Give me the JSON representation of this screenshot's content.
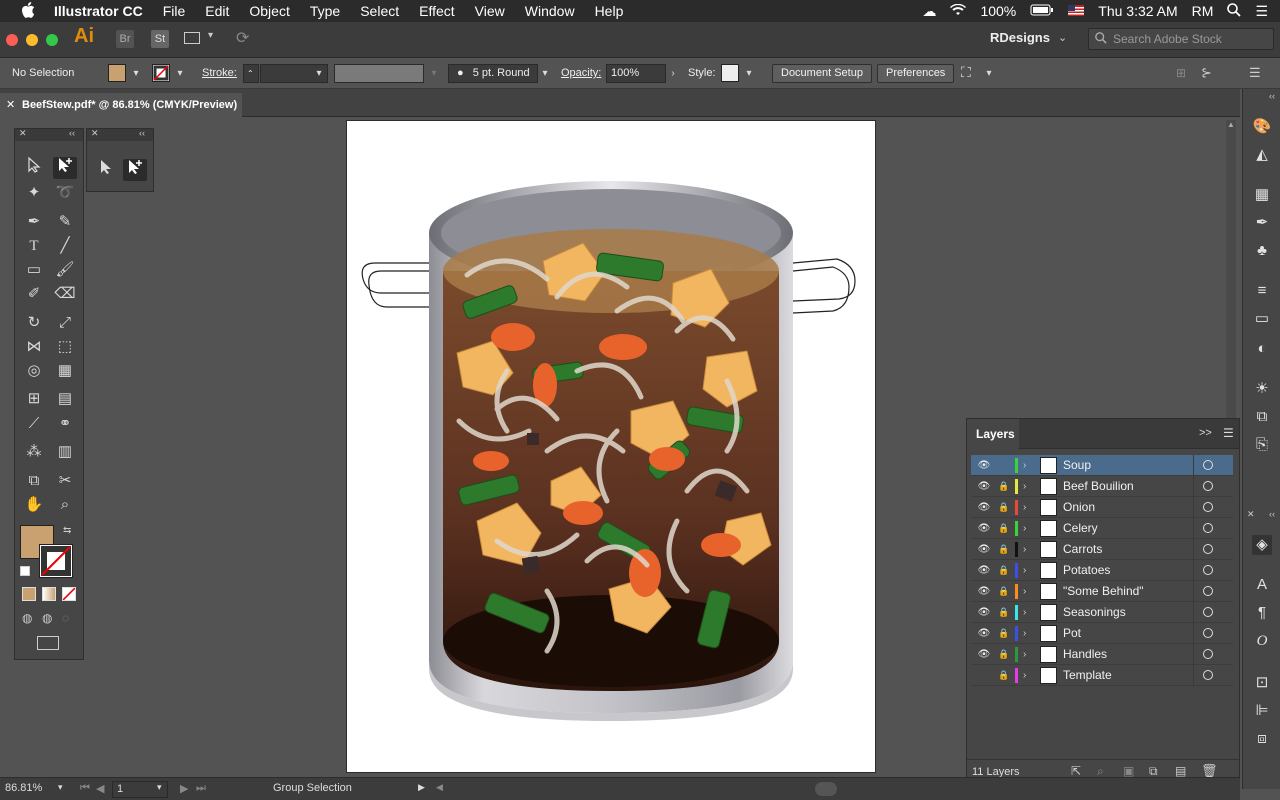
{
  "menubar": {
    "apple": "",
    "app": "Illustrator CC",
    "items": [
      "File",
      "Edit",
      "Object",
      "Type",
      "Select",
      "Effect",
      "View",
      "Window",
      "Help"
    ],
    "battery": "100%",
    "clock": "Thu 3:32 AM",
    "user": "RM"
  },
  "appbar": {
    "logo": "Ai",
    "bridge": "Br",
    "stock": "St",
    "workspace": "RDesigns",
    "search_placeholder": "Search Adobe Stock"
  },
  "control": {
    "selection": "No Selection",
    "fill_color": "#c9a170",
    "stroke_label": "Stroke:",
    "brush": "5 pt. Round",
    "opacity_label": "Opacity:",
    "opacity_value": "100%",
    "style_label": "Style:",
    "doc_setup": "Document Setup",
    "preferences": "Preferences"
  },
  "document": {
    "tab_title": "BeefStew.pdf* @ 86.81% (CMYK/Preview)"
  },
  "layers": {
    "title": "Layers",
    "count": "11 Layers",
    "items": [
      {
        "name": "Soup",
        "color": "#3ad33a",
        "selected": true,
        "visible": true,
        "locked": false
      },
      {
        "name": "Beef Bouilion",
        "color": "#e8e83a",
        "selected": false,
        "visible": true,
        "locked": true
      },
      {
        "name": "Onion",
        "color": "#e84a3a",
        "selected": false,
        "visible": true,
        "locked": true
      },
      {
        "name": "Celery",
        "color": "#3ad33a",
        "selected": false,
        "visible": true,
        "locked": true
      },
      {
        "name": "Carrots",
        "color": "#111111",
        "selected": false,
        "visible": true,
        "locked": true
      },
      {
        "name": "Potatoes",
        "color": "#3a50e8",
        "selected": false,
        "visible": true,
        "locked": true
      },
      {
        "name": "\"Some Behind\"",
        "color": "#ff8a1f",
        "selected": false,
        "visible": true,
        "locked": true
      },
      {
        "name": "Seasonings",
        "color": "#3ae8e8",
        "selected": false,
        "visible": true,
        "locked": true
      },
      {
        "name": "Pot",
        "color": "#3a50e8",
        "selected": false,
        "visible": true,
        "locked": true
      },
      {
        "name": "Handles",
        "color": "#2a9a3a",
        "selected": false,
        "visible": true,
        "locked": true
      },
      {
        "name": "Template",
        "color": "#e83ae8",
        "selected": false,
        "visible": false,
        "locked": true
      }
    ]
  },
  "status": {
    "zoom": "86.81%",
    "page": "1",
    "tool": "Group Selection"
  }
}
